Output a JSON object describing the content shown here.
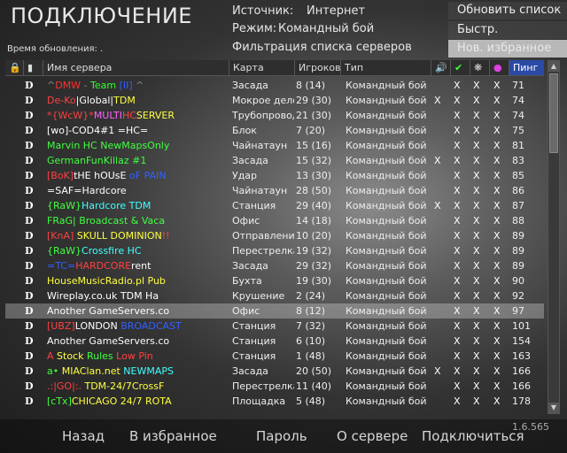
{
  "title": "ПОДКЛЮЧЕНИЕ",
  "update_time": "Время обновления: .",
  "source_label": "Источник:",
  "source_value": "Интернет",
  "mode_label": "Режим:",
  "mode_value": "Командный бой",
  "filter_label": "Фильтрация списка серверов",
  "buttons": {
    "refresh_list": "Обновить список",
    "quick_refresh": "Быстр. обновление",
    "new_favorites": "Нов. избранное",
    "back": "Назад",
    "to_favorites": "В избранное",
    "password": "Пароль",
    "about_server": "О сервере",
    "connect": "Подключиться"
  },
  "version": "1.6.565",
  "columns": {
    "name": "Имя сервера",
    "map": "Карта",
    "players": "Игроков",
    "type": "Тип",
    "ping": "Пинг"
  },
  "colors": {
    "ping_header": "#2a4aa6",
    "selected_row": "#6a6a6a"
  },
  "servers": [
    {
      "icon": "D",
      "name_parts": [
        {
          "t": "^",
          "c": "#888"
        },
        {
          "t": "DMW",
          "c": "#ff3030"
        },
        {
          "t": " - ",
          "c": "#888"
        },
        {
          "t": "Team ",
          "c": "#30ff30"
        },
        {
          "t": "[II]",
          "c": "#3060ff"
        },
        {
          "t": " ^",
          "c": "#888"
        }
      ],
      "map": "Засада",
      "players": "8 (14)",
      "type": "Командный бой",
      "x": [
        "",
        "X",
        "X",
        "X"
      ],
      "ping": "71",
      "sel": false
    },
    {
      "icon": "D",
      "name_parts": [
        {
          "t": "De-Ko",
          "c": "#ff4040"
        },
        {
          "t": "|Global|",
          "c": "#ffffff"
        },
        {
          "t": "TDM",
          "c": "#ffff40"
        }
      ],
      "map": "Мокрое дело",
      "players": "29 (30)",
      "type": "Командный бой",
      "x": [
        "X",
        "X",
        "X",
        "X"
      ],
      "ping": "74",
      "sel": false
    },
    {
      "icon": "D",
      "name_parts": [
        {
          "t": "*{WcW}*",
          "c": "#ff4040"
        },
        {
          "t": "MULTI",
          "c": "#ff60ff"
        },
        {
          "t": "HC",
          "c": "#ff4040"
        },
        {
          "t": "SERVER",
          "c": "#ffff40"
        }
      ],
      "map": "Трубопровод",
      "players": "21 (30)",
      "type": "Командный бой",
      "x": [
        "",
        "X",
        "X",
        "X"
      ],
      "ping": "74",
      "sel": false
    },
    {
      "icon": "D",
      "name_parts": [
        {
          "t": "[wo]-COD4#1 =HC=",
          "c": "#ffffff"
        }
      ],
      "map": "Блок",
      "players": "7 (20)",
      "type": "Командный бой",
      "x": [
        "",
        "X",
        "X",
        "X"
      ],
      "ping": "75",
      "sel": false
    },
    {
      "icon": "D",
      "name_parts": [
        {
          "t": "Marvin HC NewMapsOnly",
          "c": "#40ff40"
        }
      ],
      "map": "Чайнатаун",
      "players": "15 (16)",
      "type": "Командный бой",
      "x": [
        "",
        "X",
        "X",
        "X"
      ],
      "ping": "81",
      "sel": false
    },
    {
      "icon": "D",
      "name_parts": [
        {
          "t": "GermanFunKillaz #1",
          "c": "#40ff40"
        }
      ],
      "map": "Засада",
      "players": "15 (32)",
      "type": "Командный бой",
      "x": [
        "X",
        "X",
        "X",
        "X"
      ],
      "ping": "83",
      "sel": false
    },
    {
      "icon": "D",
      "name_parts": [
        {
          "t": "[BoK]",
          "c": "#ff4040"
        },
        {
          "t": "tHE hOUsE ",
          "c": "#ffffff"
        },
        {
          "t": "oF",
          "c": "#3060ff"
        },
        {
          "t": " PAIN",
          "c": "#3060ff"
        }
      ],
      "map": "Удар",
      "players": "13 (30)",
      "type": "Командный бой",
      "x": [
        "",
        "X",
        "X",
        "X"
      ],
      "ping": "85",
      "sel": false
    },
    {
      "icon": "D",
      "name_parts": [
        {
          "t": "=SAF=Hardcore",
          "c": "#ffffff"
        }
      ],
      "map": "Чайнатаун",
      "players": "28 (50)",
      "type": "Командный бой",
      "x": [
        "",
        "X",
        "X",
        "X"
      ],
      "ping": "86",
      "sel": false
    },
    {
      "icon": "D",
      "name_parts": [
        {
          "t": "{RaW}",
          "c": "#40ff40"
        },
        {
          "t": "Hardcore TDM",
          "c": "#40ffff"
        }
      ],
      "map": "Станция",
      "players": "29 (40)",
      "type": "Командный бой",
      "x": [
        "X",
        "X",
        "X",
        "X"
      ],
      "ping": "87",
      "sel": false
    },
    {
      "icon": "D",
      "name_parts": [
        {
          "t": "FRaG",
          "c": "#40ff40"
        },
        {
          "t": "| Broadcast & Vaca",
          "c": "#40ff40"
        }
      ],
      "map": "Офис",
      "players": "14 (18)",
      "type": "Командный бой",
      "x": [
        "",
        "X",
        "X",
        "X"
      ],
      "ping": "88",
      "sel": false
    },
    {
      "icon": "D",
      "name_parts": [
        {
          "t": "[KnA]",
          "c": "#ff4040"
        },
        {
          "t": " SKULL DOMINION",
          "c": "#ffff40"
        },
        {
          "t": "!!",
          "c": "#ff4040"
        }
      ],
      "map": "Отправление",
      "players": "10 (20)",
      "type": "Командный бой",
      "x": [
        "",
        "X",
        "X",
        "X"
      ],
      "ping": "89",
      "sel": false
    },
    {
      "icon": "D",
      "name_parts": [
        {
          "t": "{RaW}",
          "c": "#40ff40"
        },
        {
          "t": "Crossfire HC",
          "c": "#40ffff"
        }
      ],
      "map": "Перестрелка",
      "players": "19 (32)",
      "type": "Командный бой",
      "x": [
        "",
        "X",
        "X",
        "X"
      ],
      "ping": "89",
      "sel": false
    },
    {
      "icon": "D",
      "name_parts": [
        {
          "t": "=TC=",
          "c": "#3060ff"
        },
        {
          "t": "HARDCORE",
          "c": "#ff4040"
        },
        {
          "t": "rent",
          "c": "#ffffff"
        }
      ],
      "map": "Засада",
      "players": "29 (32)",
      "type": "Командный бой",
      "x": [
        "",
        "X",
        "X",
        "X"
      ],
      "ping": "89",
      "sel": false
    },
    {
      "icon": "D",
      "name_parts": [
        {
          "t": "HouseMusicRadio.pl Pub",
          "c": "#ffff40"
        }
      ],
      "map": "Бухта",
      "players": "19 (30)",
      "type": "Командный бой",
      "x": [
        "",
        "X",
        "X",
        "X"
      ],
      "ping": "90",
      "sel": false
    },
    {
      "icon": "D",
      "name_parts": [
        {
          "t": " Wireplay.co.uk TDM Ha",
          "c": "#ffffff"
        }
      ],
      "map": "Крушение",
      "players": "2 (24)",
      "type": "Командный бой",
      "x": [
        "",
        "X",
        "X",
        "X"
      ],
      "ping": "92",
      "sel": false
    },
    {
      "icon": "D",
      "name_parts": [
        {
          "t": "Another GameServers.co",
          "c": "#ffffff"
        }
      ],
      "map": "Офис",
      "players": "8 (12)",
      "type": "Командный бой",
      "x": [
        "",
        "X",
        "X",
        "X"
      ],
      "ping": "97",
      "sel": true
    },
    {
      "icon": "D",
      "name_parts": [
        {
          "t": "[UBZ]",
          "c": "#ff4040"
        },
        {
          "t": "LONDON ",
          "c": "#ffffff"
        },
        {
          "t": "BROADCAST",
          "c": "#3060ff"
        }
      ],
      "map": "Станция",
      "players": "7 (32)",
      "type": "Командный бой",
      "x": [
        "",
        "X",
        "X",
        "X"
      ],
      "ping": "101",
      "sel": false
    },
    {
      "icon": "D",
      "name_parts": [
        {
          "t": "Another GameServers.co",
          "c": "#ffffff"
        }
      ],
      "map": "Станция",
      "players": "6 (10)",
      "type": "Командный бой",
      "x": [
        "",
        "X",
        "X",
        "X"
      ],
      "ping": "154",
      "sel": false
    },
    {
      "icon": "D",
      "name_parts": [
        {
          "t": " A ",
          "c": "#ff4040"
        },
        {
          "t": "Stock ",
          "c": "#ffff40"
        },
        {
          "t": "Rules ",
          "c": "#40ff40"
        },
        {
          "t": "Low Pin",
          "c": "#ff4040"
        }
      ],
      "map": "Станция",
      "players": "1 (48)",
      "type": "Командный бой",
      "x": [
        "",
        "X",
        "X",
        "X"
      ],
      "ping": "163",
      "sel": false
    },
    {
      "icon": "D",
      "name_parts": [
        {
          "t": "a•",
          "c": "#40ff40"
        },
        {
          "t": " MIAClan.net ",
          "c": "#ffff40"
        },
        {
          "t": "NEWMAPS",
          "c": "#40ffff"
        }
      ],
      "map": "Засада",
      "players": "20 (50)",
      "type": "Командный бой",
      "x": [
        "X",
        "X",
        "X",
        "X"
      ],
      "ping": "166",
      "sel": false
    },
    {
      "icon": "D",
      "name_parts": [
        {
          "t": ".:|GO|:.",
          "c": "#ff4040"
        },
        {
          "t": " TDM-24/7CrossF",
          "c": "#ffff40"
        }
      ],
      "map": "Перестрелка",
      "players": "11 (40)",
      "type": "Командный бой",
      "x": [
        "",
        "X",
        "X",
        "X"
      ],
      "ping": "166",
      "sel": false
    },
    {
      "icon": "D",
      "name_parts": [
        {
          "t": "[cTx]",
          "c": "#40ff40"
        },
        {
          "t": "CHICAGO 24/7 ROTA",
          "c": "#ffff40"
        }
      ],
      "map": "Площадка",
      "players": "5 (48)",
      "type": "Командный бой",
      "x": [
        "",
        "X",
        "X",
        "X"
      ],
      "ping": "178",
      "sel": false
    }
  ]
}
